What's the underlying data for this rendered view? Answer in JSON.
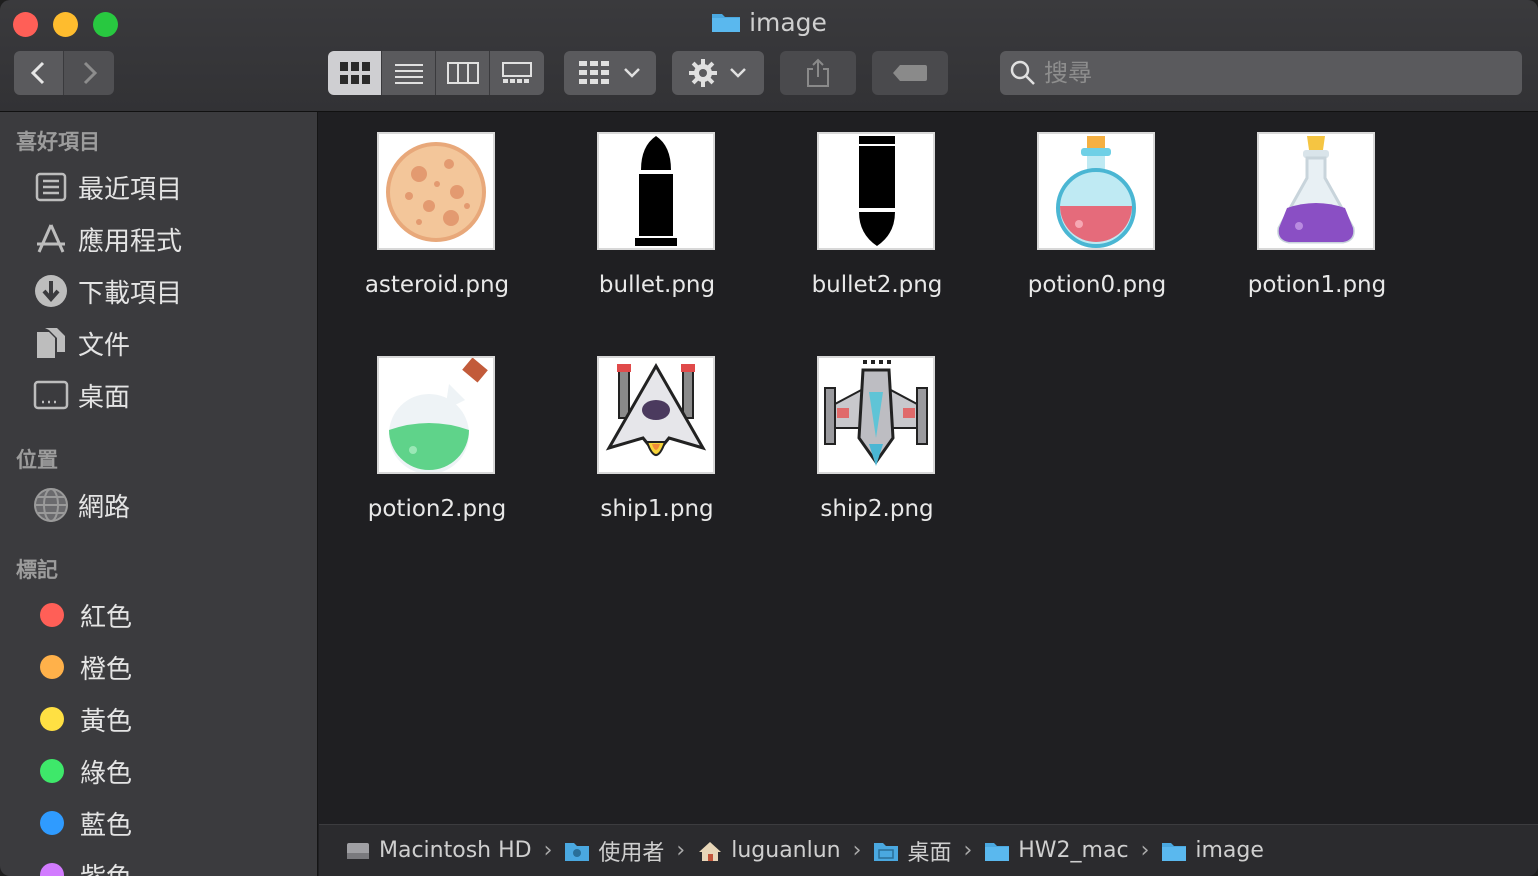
{
  "window": {
    "title": "image"
  },
  "toolbar": {
    "back_icon": "chevron-left-icon",
    "forward_icon": "chevron-right-icon",
    "view_modes": [
      "icon-view",
      "list-view",
      "column-view",
      "gallery-view"
    ],
    "active_view": "icon-view",
    "search_placeholder": "搜尋"
  },
  "sidebar": {
    "favorites_label": "喜好項目",
    "favorites": [
      {
        "label": "最近項目",
        "icon": "recents-icon"
      },
      {
        "label": "應用程式",
        "icon": "applications-icon"
      },
      {
        "label": "下載項目",
        "icon": "downloads-icon"
      },
      {
        "label": "文件",
        "icon": "documents-icon"
      },
      {
        "label": "桌面",
        "icon": "desktop-icon"
      }
    ],
    "locations_label": "位置",
    "locations": [
      {
        "label": "網路",
        "icon": "network-icon"
      }
    ],
    "tags_label": "標記",
    "tags": [
      {
        "label": "紅色",
        "color": "#ff5f57"
      },
      {
        "label": "橙色",
        "color": "#ffb14a"
      },
      {
        "label": "黃色",
        "color": "#ffe043"
      },
      {
        "label": "綠色",
        "color": "#3ee86a"
      },
      {
        "label": "藍色",
        "color": "#2f9bff"
      },
      {
        "label": "紫色",
        "color": "#d27bff"
      }
    ]
  },
  "files": [
    {
      "name": "asteroid.png",
      "icon": "asteroid-thumbnail"
    },
    {
      "name": "bullet.png",
      "icon": "bullet-thumbnail"
    },
    {
      "name": "bullet2.png",
      "icon": "bullet2-thumbnail"
    },
    {
      "name": "potion0.png",
      "icon": "potion-red-thumbnail"
    },
    {
      "name": "potion1.png",
      "icon": "potion-purple-thumbnail"
    },
    {
      "name": "potion2.png",
      "icon": "potion-green-thumbnail"
    },
    {
      "name": "ship1.png",
      "icon": "ship1-thumbnail"
    },
    {
      "name": "ship2.png",
      "icon": "ship2-thumbnail"
    }
  ],
  "pathbar": [
    {
      "label": "Macintosh HD",
      "icon": "hard-drive-icon"
    },
    {
      "label": "使用者",
      "icon": "users-folder-icon"
    },
    {
      "label": "luguanlun",
      "icon": "home-icon"
    },
    {
      "label": "桌面",
      "icon": "desktop-folder-icon"
    },
    {
      "label": "HW2_mac",
      "icon": "folder-icon"
    },
    {
      "label": "image",
      "icon": "folder-icon"
    }
  ]
}
